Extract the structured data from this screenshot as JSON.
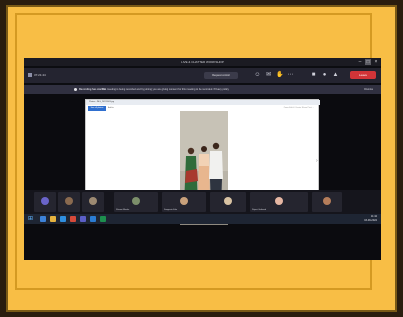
{
  "meeting": {
    "window_title": "LIVE & CHATTER WORKSHOP",
    "timer": "37:21:44",
    "share_button": "Request control",
    "leave_button": "Leave",
    "recording": {
      "title": "Recording has started",
      "message": "The meeting is being recorded and by joining you are giving consent for this meeting to be recorded. Privacy policy",
      "dismiss": "Dismiss"
    },
    "shared_screen": {
      "tab_label": "Photos - IMG_20220903.jpg",
      "ribbon_button": "See all photos",
      "ribbon_item": "Add to",
      "tools": "Zoom  Edit & Create  Share  Print  ..."
    },
    "presenter_name": "Anand Jagtap"
  },
  "gallery": {
    "participants": [
      {
        "name": "",
        "color": "#6a64c9"
      },
      {
        "name": "",
        "color": "#8a6a4f"
      },
      {
        "name": "",
        "color": "#9d8a72"
      },
      {
        "name": "Shivani Bhosle",
        "color": "#7c8f6a"
      },
      {
        "name": "Sangeeta Kale",
        "color": "#c9a17b"
      },
      {
        "name": "",
        "color": "#d9c3a3"
      },
      {
        "name": "Rajani Gaikwad",
        "color": "#e6b7a3"
      },
      {
        "name": "",
        "color": "#b57d5a"
      }
    ]
  },
  "taskbar": {
    "clock_time": "11:42",
    "clock_date": "03-09-2022"
  },
  "colors": {
    "frame": "#f8be45",
    "teams_dark": "#242430",
    "leave_red": "#d13438",
    "accent_blue": "#2f6fcf"
  }
}
